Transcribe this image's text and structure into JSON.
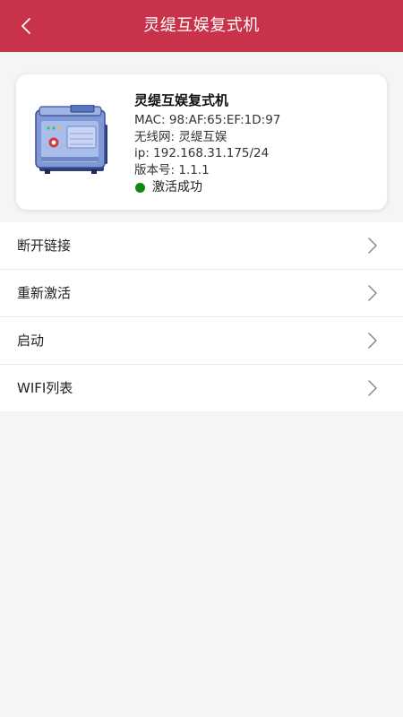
{
  "header": {
    "title": "灵缇互娱复式机",
    "back_icon": "chevron-left-icon",
    "background": "#c8334b"
  },
  "device": {
    "name": "灵缇互娱复式机",
    "mac": "MAC:  98:AF:65:EF:1D:97",
    "wifi": "无线网:  灵缇互娱",
    "ip": "ip:  192.168.31.175/24",
    "version": "版本号:  1.1.1",
    "status": "激活成功",
    "status_color": "#0f8a0f",
    "image_icon": "arcade-machine-icon"
  },
  "menu": {
    "items": [
      {
        "label": "断开链接"
      },
      {
        "label": "重新激活"
      },
      {
        "label": "启动"
      },
      {
        "label": "WIFI列表"
      }
    ],
    "chevron_icon": "chevron-right-icon"
  }
}
